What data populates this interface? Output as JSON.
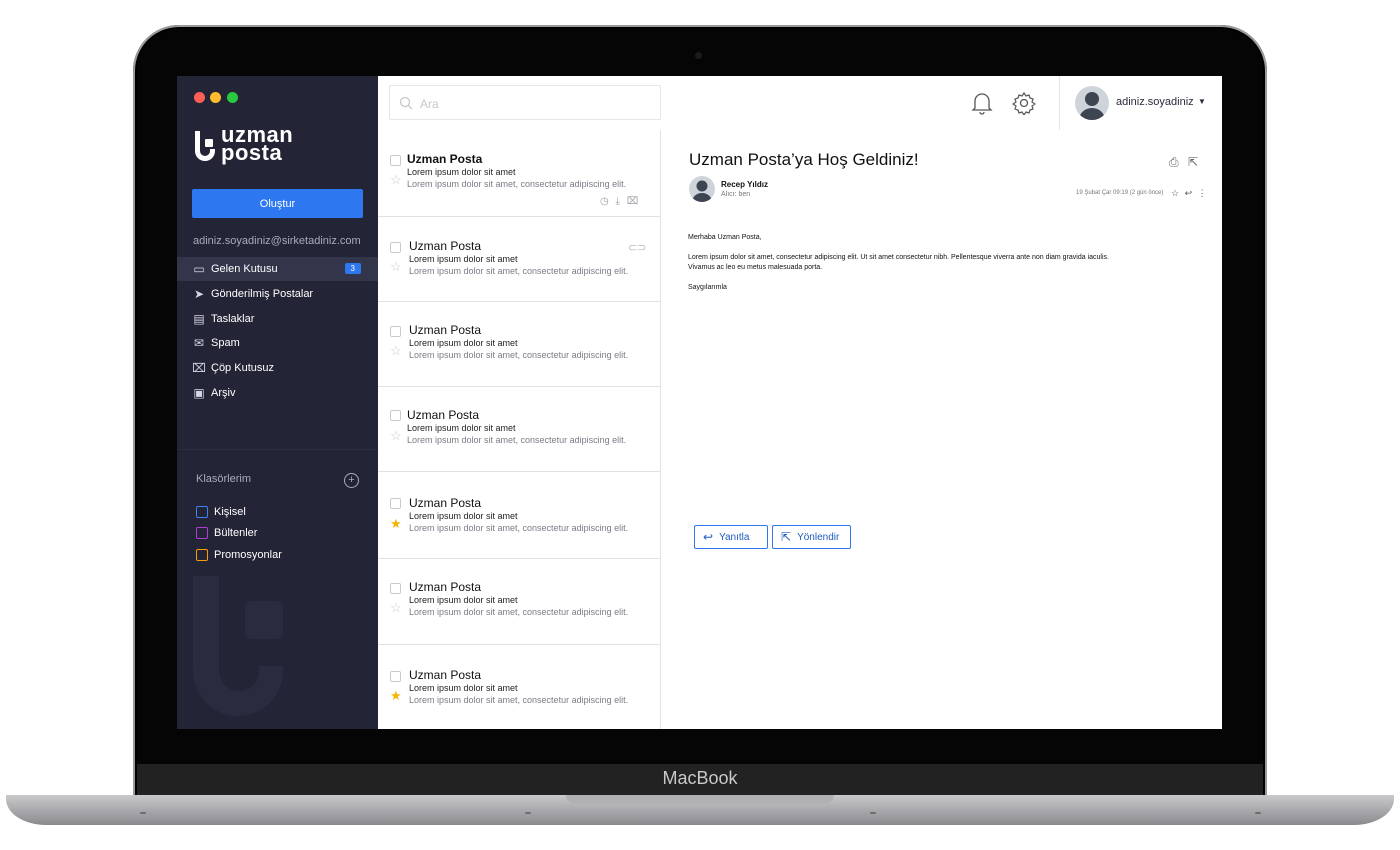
{
  "device": {
    "brand": "MacBook"
  },
  "app": {
    "logo_line1": "uzman",
    "logo_line2": "posta"
  },
  "sidebar": {
    "compose_label": "Oluştur",
    "account_email": "adiniz.soyadiniz@sirketadiniz.com",
    "items": [
      {
        "label": "Gelen Kutusu",
        "icon": "inbox-icon",
        "badge": "3"
      },
      {
        "label": "Gönderilmiş Postalar",
        "icon": "paper-plane-icon"
      },
      {
        "label": "Taslaklar",
        "icon": "draft-document-icon"
      },
      {
        "label": "Spam",
        "icon": "spam-envelope-icon"
      },
      {
        "label": "Çöp Kutusuz",
        "icon": "trash-icon"
      },
      {
        "label": "Arşiv",
        "icon": "archive-icon"
      }
    ],
    "folders_title": "Klasörlerim",
    "folders": [
      {
        "label": "Kişisel",
        "color": "#3b82f6"
      },
      {
        "label": "Bültenler",
        "color": "#b33bd6"
      },
      {
        "label": "Promosyonlar",
        "color": "#f59e0b"
      }
    ]
  },
  "topbar": {
    "search_placeholder": "Ara",
    "username": "adiniz.soyadiniz"
  },
  "mails": [
    {
      "from": "Uzman Posta",
      "subject": "Lorem ipsum dolor sit amet",
      "snippet": "Lorem ipsum dolor sit amet, consectetur adipiscing elit.",
      "starred": false,
      "selected": true
    },
    {
      "from": "Uzman Posta",
      "subject": "Lorem ipsum dolor sit amet",
      "snippet": "Lorem ipsum dolor sit amet, consectetur adipiscing elit.",
      "starred": false,
      "attachment": true
    },
    {
      "from": "Uzman Posta",
      "subject": "Lorem ipsum dolor sit amet",
      "snippet": "Lorem ipsum dolor sit amet, consectetur adipiscing elit.",
      "starred": false
    },
    {
      "from": "Uzman Posta",
      "subject": "Lorem ipsum dolor sit amet",
      "snippet": "Lorem ipsum dolor sit amet, consectetur adipiscing elit.",
      "starred": false
    },
    {
      "from": "Uzman Posta",
      "subject": "Lorem ipsum dolor sit amet",
      "snippet": "Lorem ipsum dolor sit amet, consectetur adipiscing elit.",
      "starred": true
    },
    {
      "from": "Uzman Posta",
      "subject": "Lorem ipsum dolor sit amet",
      "snippet": "Lorem ipsum dolor sit amet, consectetur adipiscing elit.",
      "starred": false
    },
    {
      "from": "Uzman Posta",
      "subject": "Lorem ipsum dolor sit amet",
      "snippet": "Lorem ipsum dolor sit amet, consectetur adipiscing elit.",
      "starred": true
    }
  ],
  "message": {
    "title": "Uzman Posta’ya Hoş Geldiniz!",
    "sender": "Recep Yıldız",
    "to": "Alıcı: ben",
    "date": "19 Şubat Çar 09:19 (2 gün önce)",
    "greeting": "Merhaba Uzman Posta,",
    "body_line1": "Lorem ipsum dolor sit amet, consectetur adipiscing elit. Ut sit amet consectetur nibh. Pellentesque viverra ante non diam gravida iaculis.",
    "body_line2": "Vivamus ac leo eu metus malesuada porta.",
    "signoff": "Saygılarımla",
    "reply_label": "Yanıtla",
    "forward_label": "Yönlendir"
  }
}
